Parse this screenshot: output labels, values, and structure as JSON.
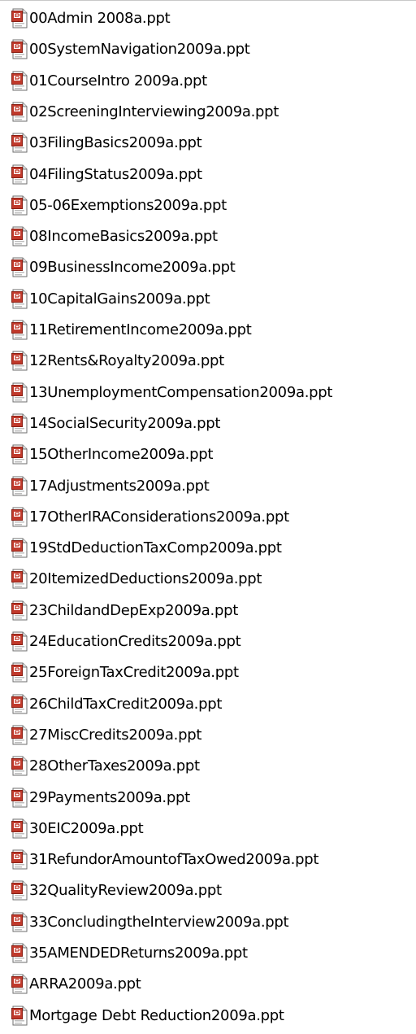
{
  "file_list": {
    "icon": "powerpoint-file-icon",
    "files": [
      "00Admin 2008a.ppt",
      "00SystemNavigation2009a.ppt",
      "01CourseIntro 2009a.ppt",
      "02ScreeningInterviewing2009a.ppt",
      "03FilingBasics2009a.ppt",
      "04FilingStatus2009a.ppt",
      "05-06Exemptions2009a.ppt",
      "08IncomeBasics2009a.ppt",
      "09BusinessIncome2009a.ppt",
      "10CapitalGains2009a.ppt",
      "11RetirementIncome2009a.ppt",
      "12Rents&Royalty2009a.ppt",
      "13UnemploymentCompensation2009a.ppt",
      "14SocialSecurity2009a.ppt",
      "15OtherIncome2009a.ppt",
      "17Adjustments2009a.ppt",
      "17OtherIRAConsiderations2009a.ppt",
      "19StdDeductionTaxComp2009a.ppt",
      "20ItemizedDeductions2009a.ppt",
      "23ChildandDepExp2009a.ppt",
      "24EducationCredits2009a.ppt",
      "25ForeignTaxCredit2009a.ppt",
      "26ChildTaxCredit2009a.ppt",
      "27MiscCredits2009a.ppt",
      "28OtherTaxes2009a.ppt",
      "29Payments2009a.ppt",
      "30EIC2009a.ppt",
      "31RefundorAmountofTaxOwed2009a.ppt",
      "32QualityReview2009a.ppt",
      "33ConcludingtheInterview2009a.ppt",
      "35AMENDEDReturns2009a.ppt",
      "ARRA2009a.ppt",
      "Mortgage Debt Reduction2009a.ppt"
    ]
  }
}
